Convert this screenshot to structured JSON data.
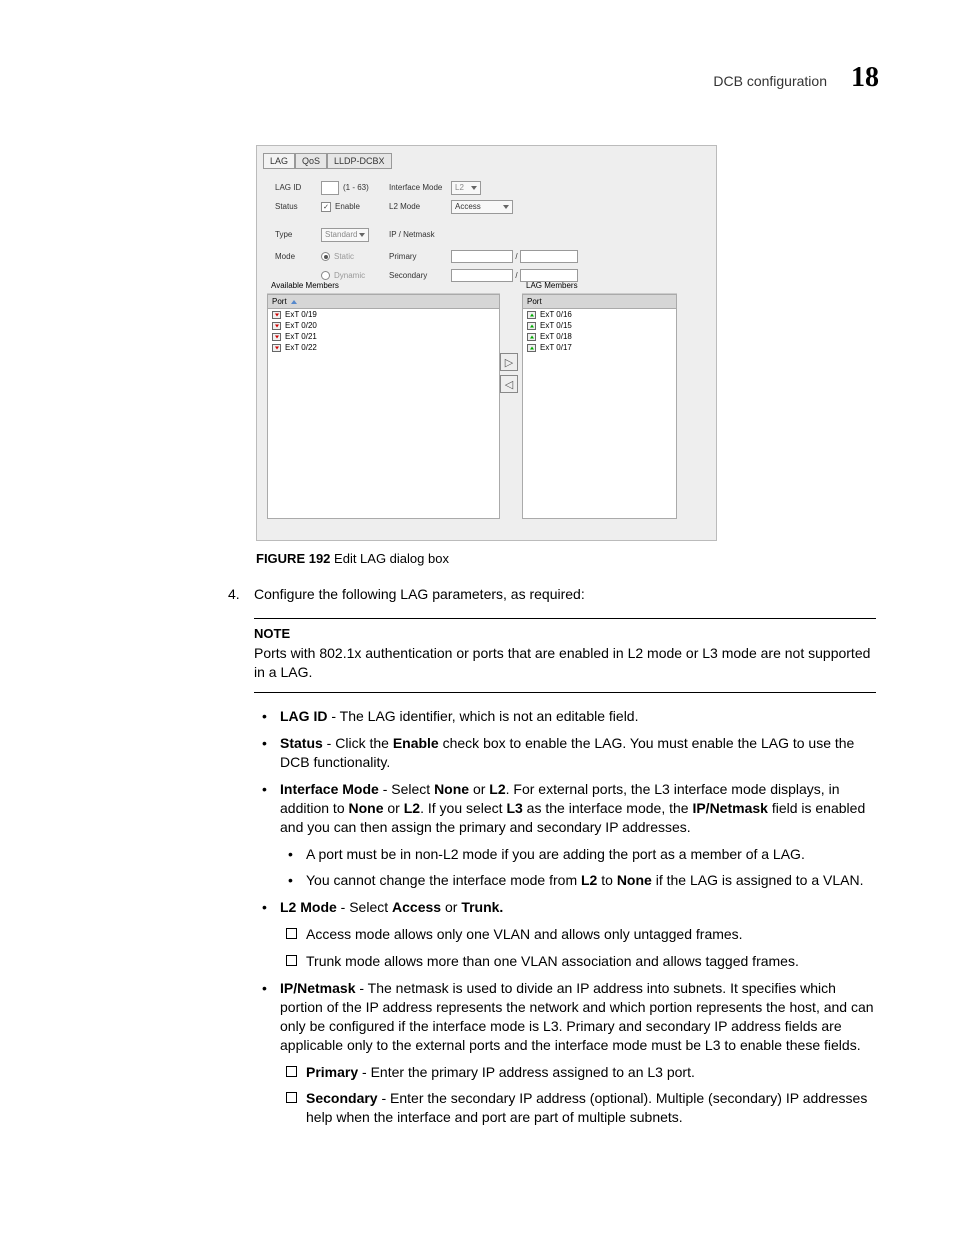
{
  "header": {
    "title": "DCB configuration",
    "number": "18"
  },
  "screenshot": {
    "tabs": [
      "LAG",
      "QoS",
      "LLDP-DCBX"
    ],
    "lagid_label": "LAG ID",
    "lagid_range": "(1 - 63)",
    "status_label": "Status",
    "enable_label": "Enable",
    "type_label": "Type",
    "type_value": "Standard",
    "mode_label": "Mode",
    "mode_static": "Static",
    "mode_dynamic": "Dynamic",
    "ifmode_label": "Interface Mode",
    "ifmode_value": "L2",
    "l2mode_label": "L2 Mode",
    "l2mode_value": "Access",
    "ipnetmask_label": "IP / Netmask",
    "primary_label": "Primary",
    "secondary_label": "Secondary",
    "avail_title": "Available Members",
    "port_header": "Port",
    "avail_items": [
      "ExT 0/19",
      "ExT 0/20",
      "ExT 0/21",
      "ExT 0/22"
    ],
    "lag_title": "LAG Members",
    "lag_items": [
      "ExT 0/16",
      "ExT 0/15",
      "ExT 0/18",
      "ExT 0/17"
    ]
  },
  "figure": {
    "num": "FIGURE 192",
    "caption": "Edit LAG dialog box"
  },
  "content": {
    "step_num": "4.",
    "step_text": "Configure the following LAG parameters, as required:",
    "note_title": "NOTE",
    "note_text": "Ports with 802.1x authentication or ports that are enabled in L2 mode or L3 mode are not supported in a LAG.",
    "b_lagid": "LAG ID",
    "t_lagid": " - The LAG identifier, which is not an editable field.",
    "b_status": "Status",
    "t_status_1": " - Click the ",
    "b_enable": "Enable",
    "t_status_2": " check box to enable the LAG. You must enable the LAG to use the DCB functionality.",
    "b_ifmode": "Interface Mode",
    "t_if_1": " - Select ",
    "b_none": "None",
    "t_if_or": " or ",
    "b_l2": "L2",
    "t_if_2": ". For external ports, the L3 interface mode displays, in addition to ",
    "t_if_3": ". If you select ",
    "b_l3": "L3",
    "t_if_4": " as the interface mode, the ",
    "b_ipnet": "IP/Netmask",
    "t_if_5": " field is enabled and you can then assign the primary and secondary IP addresses.",
    "t_sub1": "A port must be in non-L2 mode if you are adding the port as a member of a LAG.",
    "t_sub2_1": "You cannot change the interface mode from ",
    "t_sub2_2": " to ",
    "t_sub2_3": " if the LAG is assigned to a VLAN.",
    "b_l2mode": "L2 Mode",
    "t_l2m_1": " - Select ",
    "b_access": "Access",
    "b_trunk": "Trunk.",
    "t_acc": "Access mode allows only one VLAN and allows only untagged frames.",
    "t_trunk": "Trunk mode allows more than one VLAN association and allows tagged frames.",
    "t_ipnet": " - The netmask is used to divide an IP address into subnets. It specifies which portion of the IP address represents the network and which portion represents the host, and can only be configured if the interface mode is L3. Primary and secondary IP address fields are applicable only to the external ports and the interface mode must be L3 to enable these fields.",
    "b_primary": "Primary",
    "t_primary": " - Enter the primary IP address assigned to an L3 port.",
    "b_secondary": "Secondary",
    "t_secondary": " - Enter the secondary IP address (optional). Multiple (secondary) IP addresses help when the interface and port are part of multiple subnets."
  }
}
